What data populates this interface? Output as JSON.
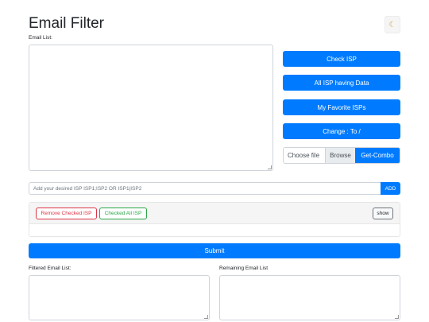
{
  "header": {
    "title": "Email Filter",
    "theme_icon": "moon-icon"
  },
  "email_list": {
    "label": "Email List:",
    "value": ""
  },
  "actions": {
    "check_isp": "Check ISP",
    "all_isp_data": "All ISP having Data",
    "favorite_isps": "My Favorite ISPs",
    "change": "Change : To /"
  },
  "file": {
    "choose": "Choose file",
    "browse": "Browse",
    "combo": "Get-Combo"
  },
  "isp_input": {
    "placeholder": "Add your desired ISP ISP1;ISP2 OR ISP1|ISP2",
    "add_label": "ADD"
  },
  "isp_panel": {
    "remove_checked": "Remove Checked ISP",
    "checked_all": "Checked All ISP",
    "show": "show"
  },
  "submit": "Submit",
  "output": {
    "filtered_label": "Filtered Email List:",
    "remaining_label": "Remaining Email List"
  },
  "colors": {
    "primary": "#007bff",
    "danger": "#dc3545",
    "success": "#28a745"
  }
}
